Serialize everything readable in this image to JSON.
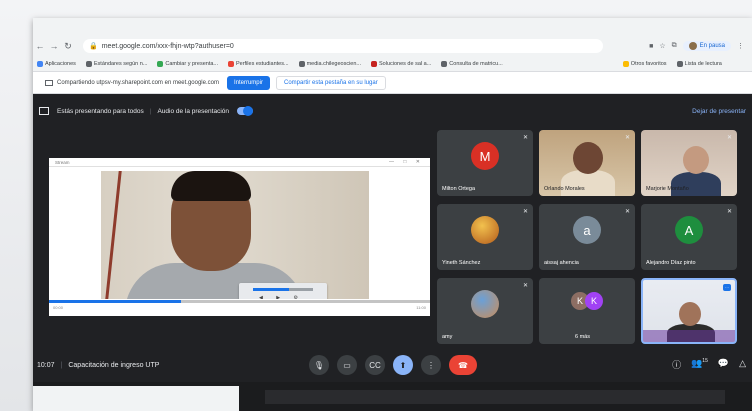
{
  "browser": {
    "url": "meet.google.com/xxx-fhjn-wtp?authuser=0",
    "profile_label": "En pausa",
    "bookmarks": [
      "Aplicaciones",
      "Estándares según n...",
      "Cambiar y presenta...",
      "Perfiles estudiantes...",
      "media.chilegeoscien...",
      "Soluciones de sal a...",
      "Consulta de matricu...",
      "Otros favoritos",
      "Lista de lectura"
    ]
  },
  "share_bar": {
    "text": "Compartiendo utpsv-my.sharepoint.com en meet.google.com",
    "stop_label": "Interrumpir",
    "switch_label": "Compartir esta pestaña en su lugar"
  },
  "presentation_bar": {
    "presenting_label": "Estás presentando para todos",
    "audio_label": "Audio de la presentación",
    "stop_label": "Dejar de presentar"
  },
  "presented": {
    "window_title": "Stream",
    "time_start": "00:00",
    "time_end": "11:00",
    "progress": 0.35
  },
  "participants": [
    {
      "name": "Milton Ortega",
      "initial": "M",
      "color": "#d93025"
    },
    {
      "name": "Orlando Morales",
      "initial": ""
    },
    {
      "name": "Marjorie Montaño",
      "initial": ""
    },
    {
      "name": "Yineth Sánchez",
      "initial": ""
    },
    {
      "name": "aissaj ahencia",
      "initial": "a",
      "color": "#7a8b99"
    },
    {
      "name": "Alejandro Díaz pinto",
      "initial": "A",
      "color": "#1e8e3e"
    },
    {
      "name": "amy",
      "initial": ""
    },
    {
      "name": "6 más",
      "initials": [
        "K",
        "K"
      ],
      "colors": [
        "#8d6e63",
        "#a142f4"
      ]
    },
    {
      "name": "",
      "initial": "",
      "more_label": "···"
    }
  ],
  "bottom_bar": {
    "time": "10:07",
    "meeting_title": "Capacitación de ingreso UTP",
    "controls": [
      "mic",
      "camera",
      "captions",
      "present",
      "more",
      "end"
    ],
    "right_icons": [
      "info",
      "people",
      "chat",
      "activities"
    ],
    "people_count": "15"
  },
  "colors": {
    "meet_bg": "#202124",
    "tile_bg": "#3c4043",
    "accent": "#8ab4f8",
    "end_call": "#ea4335"
  }
}
